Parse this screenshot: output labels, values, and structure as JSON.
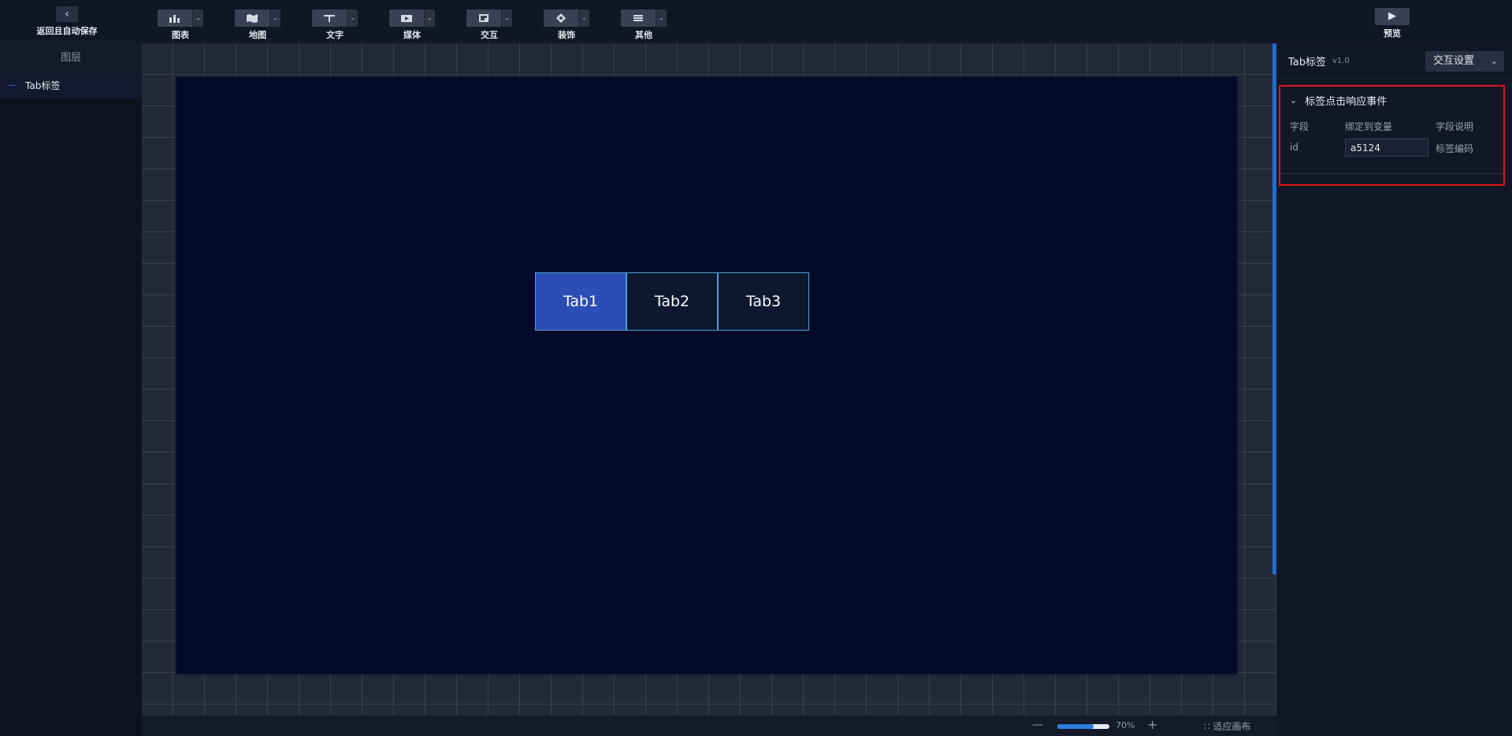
{
  "header": {
    "back_label": "返回且自动保存",
    "tools": [
      {
        "label": "图表",
        "icon": "chart-icon"
      },
      {
        "label": "地图",
        "icon": "map-icon"
      },
      {
        "label": "文字",
        "icon": "text-icon"
      },
      {
        "label": "媒体",
        "icon": "media-icon"
      },
      {
        "label": "交互",
        "icon": "interaction-icon"
      },
      {
        "label": "装饰",
        "icon": "decoration-icon"
      },
      {
        "label": "其他",
        "icon": "other-icon"
      }
    ],
    "preview_label": "预览"
  },
  "layers": {
    "title": "图层",
    "items": [
      {
        "label": "Tab标签"
      }
    ]
  },
  "canvas": {
    "tabs": [
      {
        "label": "Tab1",
        "active": true
      },
      {
        "label": "Tab2",
        "active": false
      },
      {
        "label": "Tab3",
        "active": false
      }
    ]
  },
  "bottom": {
    "zoom_value": "70%",
    "zoom_fraction": 0.7,
    "fit_label": "适应画布"
  },
  "panel": {
    "component_title": "Tab标签",
    "version": "v1.0",
    "mode_select": "交互设置",
    "event": {
      "title": "标签点击响应事件",
      "col_field": "字段",
      "col_bind": "绑定到变量",
      "col_desc": "字段说明",
      "rows": [
        {
          "field": "id",
          "variable": "a5124",
          "desc": "标签编码"
        }
      ]
    }
  },
  "colors": {
    "accent": "#2b4db5",
    "highlight_border": "#e0141e",
    "stage_bg": "#020b2a"
  }
}
